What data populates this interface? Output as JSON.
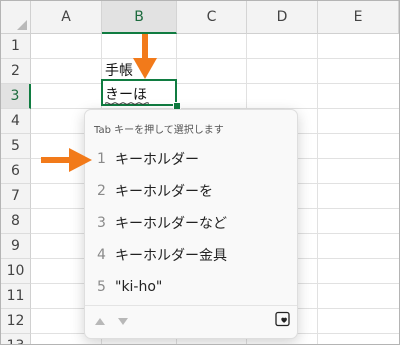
{
  "columns": [
    "A",
    "B",
    "C",
    "D",
    "E"
  ],
  "rows": [
    "1",
    "2",
    "3",
    "4",
    "5",
    "6",
    "7",
    "8",
    "9",
    "10",
    "11",
    "12",
    "13"
  ],
  "active_column": "B",
  "active_row": "3",
  "cells": {
    "b2": "手帳",
    "b3_composing": "きーほ"
  },
  "ime_popup": {
    "hint": "Tab キーを押して選択します",
    "candidates": [
      {
        "num": "1",
        "text": "キーホルダー"
      },
      {
        "num": "2",
        "text": "キーホルダーを"
      },
      {
        "num": "3",
        "text": "キーホルダーなど"
      },
      {
        "num": "4",
        "text": "キーホルダー金具"
      },
      {
        "num": "5",
        "text": "\"ki-ho\""
      }
    ],
    "up_icon": "chevron-up-icon",
    "down_icon": "chevron-down-icon",
    "extra_icon": "heart-icon"
  },
  "colors": {
    "accent_green": "#107c41",
    "arrow_orange": "#f27a1a"
  }
}
